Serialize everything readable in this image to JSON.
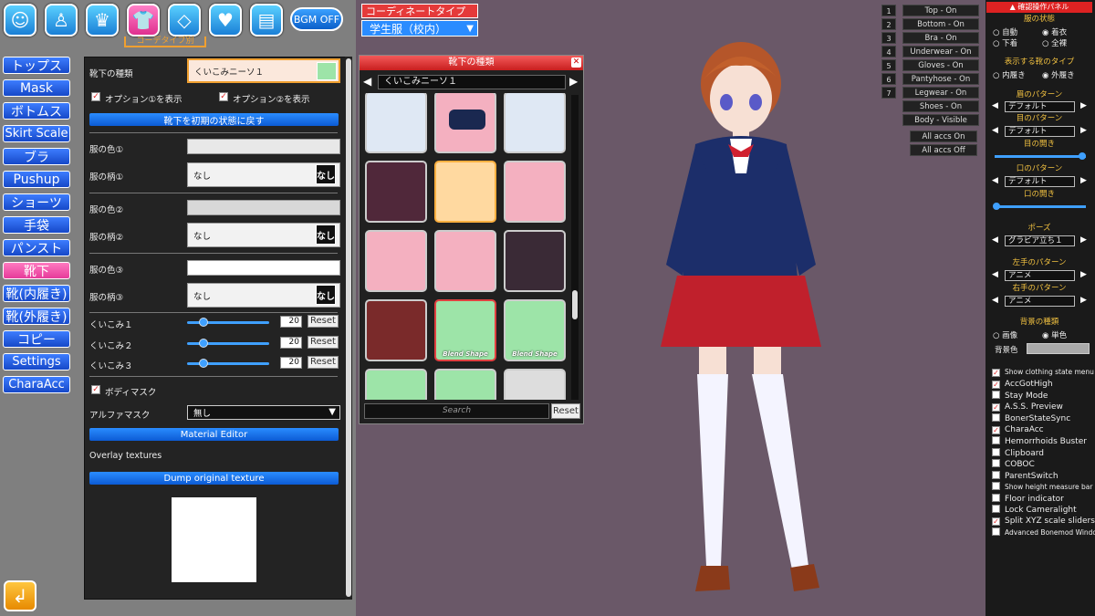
{
  "top_icons": [
    "face-icon",
    "body-icon",
    "hair-icon",
    "clothes-icon",
    "accessory-icon",
    "heart-icon",
    "document-icon"
  ],
  "bgm_label": "BGM OFF",
  "coord_tab_label": "コーデタイプ別",
  "nav": [
    "トップス",
    "Mask",
    "ボトムス",
    "Skirt Scale",
    "ブラ",
    "Pushup",
    "ショーツ",
    "手袋",
    "パンスト",
    "靴下",
    "靴(内履き)",
    "靴(外履き)",
    "コピー",
    "Settings",
    "CharaAcc"
  ],
  "panel": {
    "socks_type_label": "靴下の種類",
    "socks_type_value": "くいこみニーソ１",
    "option1": "オプション①を表示",
    "option2": "オプション②を表示",
    "reset_state": "靴下を初期の状態に戻す",
    "color1": "服の色①",
    "pattern1": "服の柄①",
    "pattern1_value": "なし",
    "color2": "服の色②",
    "pattern2": "服の柄②",
    "pattern2_value": "なし",
    "color3": "服の色③",
    "pattern3": "服の柄③",
    "pattern3_value": "なし",
    "nashi": "なし",
    "sliders": [
      {
        "label": "くいこみ１",
        "value": "20"
      },
      {
        "label": "くいこみ２",
        "value": "20"
      },
      {
        "label": "くいこみ３",
        "value": "20"
      }
    ],
    "reset": "Reset",
    "bodymask": "ボディマスク",
    "alphamask_label": "アルファマスク",
    "alphamask_value": "無し",
    "material_editor": "Material Editor",
    "overlay": "Overlay textures",
    "dump": "Dump original texture"
  },
  "coord": {
    "type_label": "コーディネートタイプ",
    "type_value": "学生服（校内）"
  },
  "picker": {
    "title": "靴下の種類",
    "selected": "くいこみニーソ１",
    "blend_label": "Blend Shape",
    "search_placeholder": "Search",
    "reset": "Reset"
  },
  "clothing_states": [
    {
      "n": "1",
      "label": "Top - On"
    },
    {
      "n": "2",
      "label": "Bottom - On"
    },
    {
      "n": "3",
      "label": "Bra - On"
    },
    {
      "n": "4",
      "label": "Underwear - On"
    },
    {
      "n": "5",
      "label": "Gloves - On"
    },
    {
      "n": "6",
      "label": "Pantyhose - On"
    },
    {
      "n": "7",
      "label": "Legwear - On"
    },
    {
      "n": "",
      "label": "Shoes - On"
    },
    {
      "n": "",
      "label": "Body - Visible"
    }
  ],
  "accs": [
    "All accs On",
    "All accs Off"
  ],
  "right": {
    "title": "▲ 確認操作パネル",
    "clothes_state": "服の状態",
    "auto": "自動",
    "wear": "着衣",
    "under": "下着",
    "nude": "全裸",
    "shoe_type": "表示する靴のタイプ",
    "inside": "内履き",
    "outside": "外履き",
    "eyebrow": "眉のパターン",
    "eyebrow_value": "デフォルト",
    "eye": "目のパターン",
    "eye_value": "デフォルト",
    "eye_open": "目の開き",
    "mouth": "口のパターン",
    "mouth_value": "デフォルト",
    "mouth_open": "口の開き",
    "pose": "ポーズ",
    "pose_value": "グラビア立ち１",
    "left_hand": "左手のパターン",
    "left_hand_value": "アニメ",
    "right_hand": "右手のパターン",
    "right_hand_value": "アニメ",
    "bg_type": "背景の種類",
    "image": "画像",
    "solid": "単色",
    "bg_color": "背景色"
  },
  "plugins": [
    {
      "label": "Show clothing state menu",
      "checked": true,
      "small": true
    },
    {
      "label": "AccGotHigh",
      "checked": true
    },
    {
      "label": "Stay Mode",
      "checked": false
    },
    {
      "label": "A.S.S. Preview",
      "checked": true
    },
    {
      "label": "BonerStateSync",
      "checked": false
    },
    {
      "label": "CharaAcc",
      "checked": true
    },
    {
      "label": "Hemorrhoids Buster",
      "checked": false
    },
    {
      "label": "Clipboard",
      "checked": false
    },
    {
      "label": "COBOC",
      "checked": false
    },
    {
      "label": "ParentSwitch",
      "checked": false
    },
    {
      "label": "Show height measure bar",
      "checked": false,
      "small": true
    },
    {
      "label": "Floor indicator",
      "checked": false
    },
    {
      "label": "Lock Cameralight",
      "checked": false
    },
    {
      "label": "Split XYZ scale sliders",
      "checked": true
    },
    {
      "label": "Advanced Bonemod Window",
      "checked": false,
      "small": true
    }
  ],
  "colors": {
    "accent_blue": "#2a8cff",
    "accent_pink": "#e63a9a",
    "accent_red": "#d22",
    "gold": "#f0c040"
  }
}
